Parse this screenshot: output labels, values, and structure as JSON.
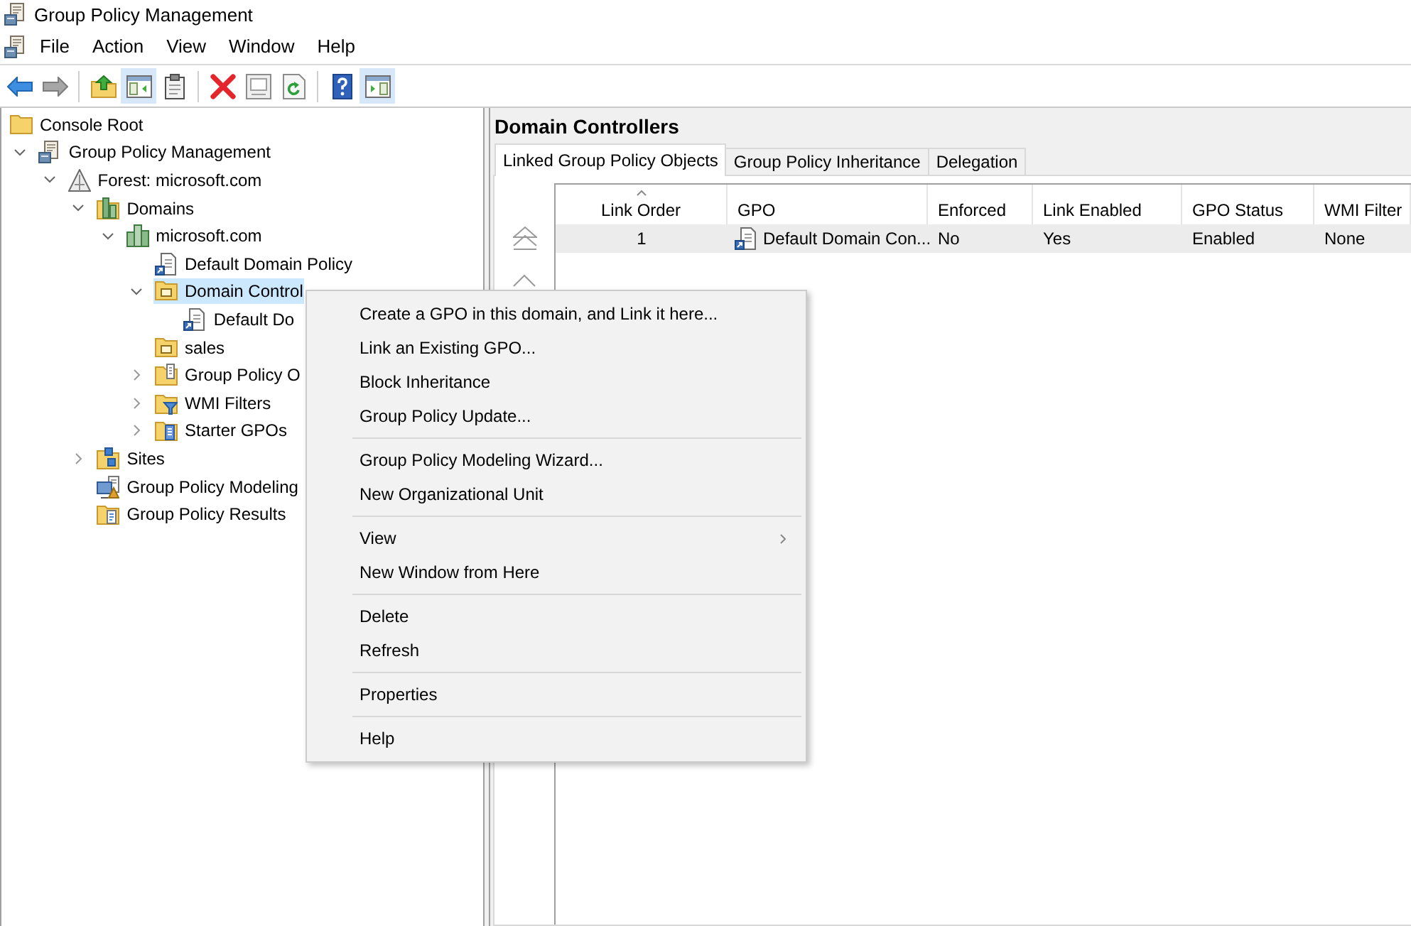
{
  "window": {
    "title": "Group Policy Management"
  },
  "menu_bar": {
    "items": [
      "File",
      "Action",
      "View",
      "Window",
      "Help"
    ]
  },
  "toolbar": {
    "groups": [
      [
        {
          "kind": "back",
          "pressed": false,
          "disabled": false
        },
        {
          "kind": "forward",
          "pressed": false,
          "disabled": true
        }
      ],
      [
        {
          "kind": "up",
          "pressed": false,
          "disabled": false
        },
        {
          "kind": "console-tree",
          "pressed": true,
          "disabled": false
        },
        {
          "kind": "export",
          "pressed": false,
          "disabled": false
        }
      ],
      [
        {
          "kind": "delete",
          "pressed": false,
          "disabled": false
        },
        {
          "kind": "properties",
          "pressed": false,
          "disabled": false
        },
        {
          "kind": "refresh",
          "pressed": false,
          "disabled": false
        }
      ],
      [
        {
          "kind": "help",
          "pressed": false,
          "disabled": false
        },
        {
          "kind": "action-pane",
          "pressed": true,
          "disabled": false
        }
      ]
    ]
  },
  "tree": {
    "nodes": [
      {
        "label": "Console Root",
        "kind": "folder",
        "selected": false,
        "children": [
          {
            "label": "Group Policy Management",
            "kind": "console",
            "expanded": true,
            "selected": false,
            "children": [
              {
                "label": "Forest: microsoft.com",
                "kind": "forest",
                "expanded": true,
                "selected": false,
                "children": [
                  {
                    "label": "Domains",
                    "kind": "domains",
                    "expanded": true,
                    "selected": false,
                    "children": [
                      {
                        "label": "microsoft.com",
                        "kind": "domain",
                        "expanded": true,
                        "selected": false,
                        "children": [
                          {
                            "label": "Default Domain Policy",
                            "kind": "gpo-link",
                            "selected": false
                          },
                          {
                            "label": "Domain Control",
                            "kind": "ou",
                            "expanded": true,
                            "selected": true,
                            "children": [
                              {
                                "label": "Default Do",
                                "kind": "gpo-link",
                                "selected": false
                              }
                            ]
                          },
                          {
                            "label": "sales",
                            "kind": "ou",
                            "selected": false
                          },
                          {
                            "label": "Group Policy O",
                            "kind": "gpo-folder",
                            "expanded": false,
                            "selected": false
                          },
                          {
                            "label": "WMI Filters",
                            "kind": "filter-folder",
                            "expanded": false,
                            "selected": false
                          },
                          {
                            "label": "Starter GPOs",
                            "kind": "starter-folder",
                            "expanded": false,
                            "selected": false
                          }
                        ]
                      }
                    ]
                  },
                  {
                    "label": "Sites",
                    "kind": "sites",
                    "expanded": false,
                    "selected": false
                  },
                  {
                    "label": "Group Policy Modeling",
                    "kind": "modeling",
                    "selected": false
                  },
                  {
                    "label": "Group Policy Results",
                    "kind": "results",
                    "selected": false
                  }
                ]
              }
            ]
          }
        ]
      }
    ]
  },
  "details": {
    "title": "Domain Controllers",
    "tabs": [
      {
        "label": "Linked Group Policy Objects",
        "selected": true
      },
      {
        "label": "Group Policy Inheritance",
        "selected": false
      },
      {
        "label": "Delegation",
        "selected": false
      }
    ],
    "table": {
      "columns": [
        {
          "label": "Link Order",
          "sorted": true
        },
        {
          "label": "GPO",
          "sorted": false
        },
        {
          "label": "Enforced",
          "sorted": false
        },
        {
          "label": "Link Enabled",
          "sorted": false
        },
        {
          "label": "GPO Status",
          "sorted": false
        },
        {
          "label": "WMI Filter",
          "sorted": false
        }
      ],
      "rows": [
        {
          "cells": [
            "1",
            "Default Domain Con...",
            "No",
            "Yes",
            "Enabled",
            "None"
          ],
          "selected": true
        }
      ]
    }
  },
  "context_menu": {
    "groups": [
      [
        {
          "label": "Create a GPO in this domain, and Link it here...",
          "submenu": false
        },
        {
          "label": "Link an Existing GPO...",
          "submenu": false
        },
        {
          "label": "Block Inheritance",
          "submenu": false
        },
        {
          "label": "Group Policy Update...",
          "submenu": false
        }
      ],
      [
        {
          "label": "Group Policy Modeling Wizard...",
          "submenu": false
        },
        {
          "label": "New Organizational Unit",
          "submenu": false
        }
      ],
      [
        {
          "label": "View",
          "submenu": true
        },
        {
          "label": "New Window from Here",
          "submenu": false
        }
      ],
      [
        {
          "label": "Delete",
          "submenu": false
        },
        {
          "label": "Refresh",
          "submenu": false
        }
      ],
      [
        {
          "label": "Properties",
          "submenu": false
        }
      ],
      [
        {
          "label": "Help",
          "submenu": false
        }
      ]
    ]
  }
}
